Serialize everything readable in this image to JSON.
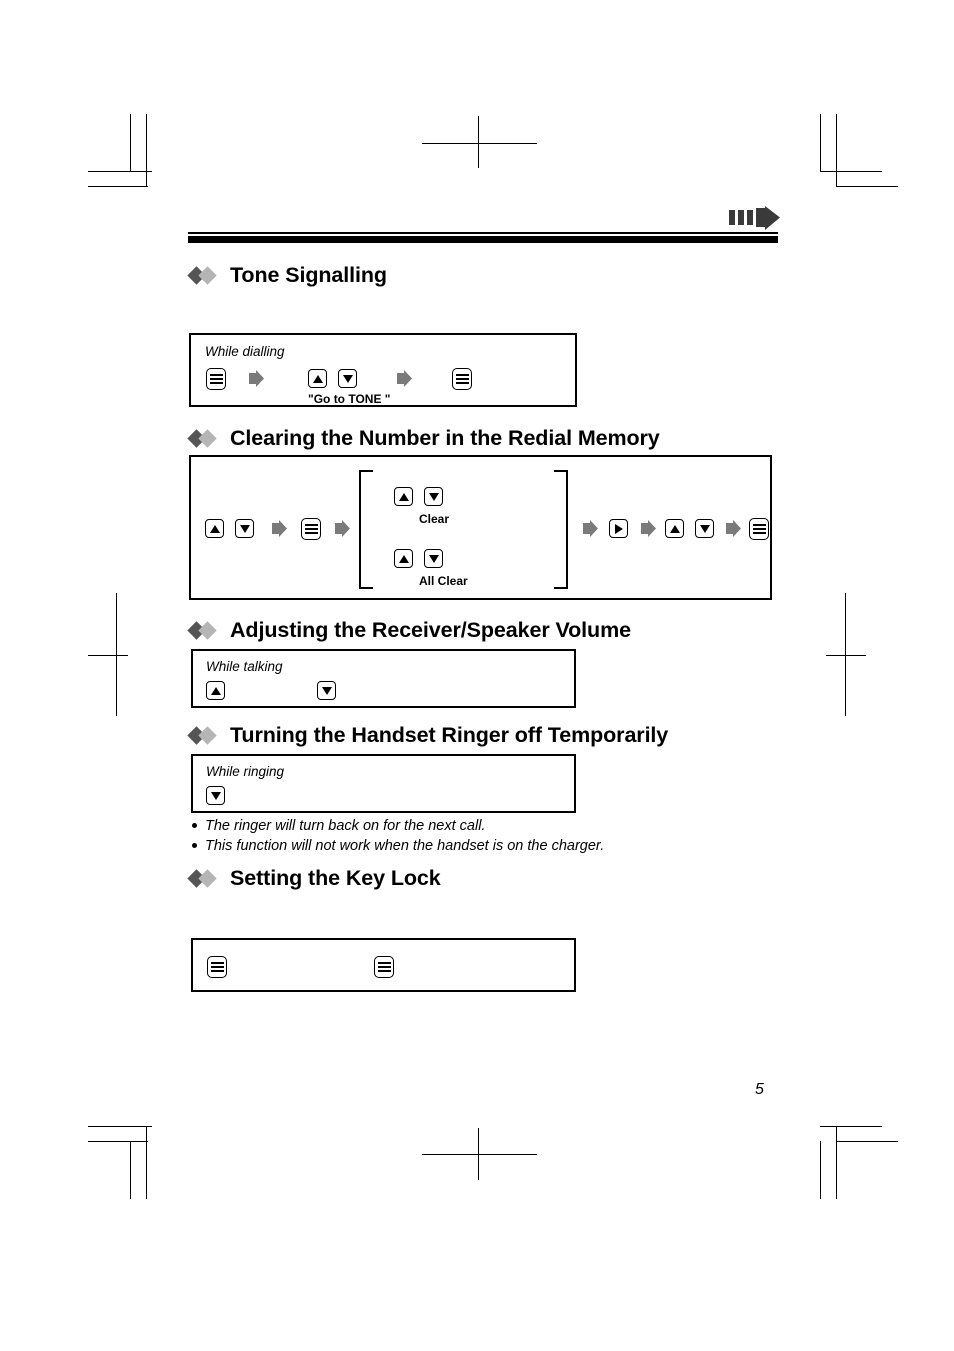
{
  "document": {
    "page_number": "5",
    "header_marker_icon": "fast-forward-icon"
  },
  "sections": [
    {
      "id": "tone-signalling",
      "title": "Tone Signalling",
      "caption": "While dialling",
      "steps": [
        {
          "icon": "menu-key-icon"
        },
        {
          "icon": "step-arrow-icon"
        },
        {
          "icon": "up-arrow-key-icon"
        },
        {
          "icon": "down-arrow-key-icon"
        },
        {
          "icon": "step-arrow-icon"
        },
        {
          "icon": "menu-key-icon"
        }
      ],
      "labels": [
        "\"Go to TONE \""
      ]
    },
    {
      "id": "clearing-redial-memory",
      "title": "Clearing the Number in the Redial Memory",
      "caption": "",
      "steps": [
        {
          "icon": "up-arrow-key-icon"
        },
        {
          "icon": "down-arrow-key-icon"
        },
        {
          "icon": "step-arrow-icon"
        },
        {
          "icon": "menu-key-icon"
        },
        {
          "icon": "step-arrow-icon"
        },
        {
          "icon": "step-arrow-icon"
        },
        {
          "icon": "right-arrow-key-icon"
        },
        {
          "icon": "step-arrow-icon"
        },
        {
          "icon": "up-arrow-key-icon"
        },
        {
          "icon": "down-arrow-key-icon"
        },
        {
          "icon": "step-arrow-icon"
        },
        {
          "icon": "menu-key-icon"
        }
      ],
      "options": [
        {
          "label": "Clear",
          "keys": [
            "up-arrow-key-icon",
            "down-arrow-key-icon"
          ]
        },
        {
          "label": "All Clear",
          "keys": [
            "up-arrow-key-icon",
            "down-arrow-key-icon"
          ]
        }
      ]
    },
    {
      "id": "adjusting-volume",
      "title": "Adjusting the Receiver/Speaker Volume",
      "caption": "While talking",
      "steps": [
        {
          "icon": "up-arrow-key-icon"
        },
        {
          "icon": "down-arrow-key-icon"
        }
      ]
    },
    {
      "id": "ringer-off",
      "title": "Turning the Handset Ringer off Temporarily",
      "caption": "While ringing",
      "steps": [
        {
          "icon": "down-arrow-key-icon"
        }
      ]
    },
    {
      "id": "key-lock",
      "title": "Setting the Key Lock",
      "caption": "",
      "steps": [
        {
          "icon": "menu-key-icon"
        },
        {
          "icon": "menu-key-icon"
        }
      ]
    }
  ],
  "notes": [
    "The ringer will turn back on for the next call.",
    "This function will not work when the handset is on the charger."
  ],
  "colors": {
    "ink": "#000000",
    "diamond_dark": "#555555",
    "diamond_light": "#b5b5b5",
    "step_arrow": "#7a7a7a",
    "page_background": "#ffffff"
  }
}
